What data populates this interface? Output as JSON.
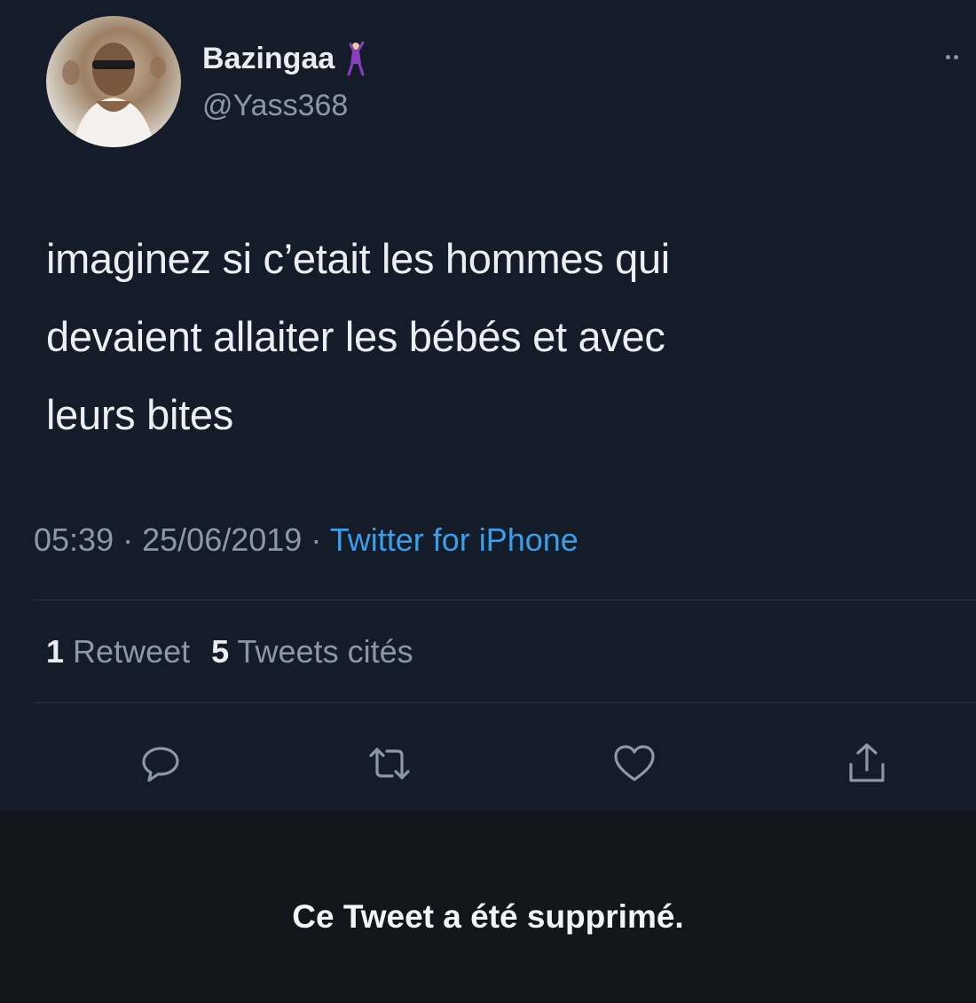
{
  "tweet": {
    "author": {
      "display_name": "Bazingaa",
      "handle": "@Yass368",
      "name_emoji": "dancing-person-emoji"
    },
    "text_lines": [
      "imaginez si c’etait les hommes qui",
      "devaient allaiter les bébés et avec",
      "leurs bites"
    ],
    "time": "05:39",
    "date": "25/06/2019",
    "separator": "·",
    "source": "Twitter for iPhone",
    "stats": {
      "retweets_count": "1",
      "retweets_label": "Retweet",
      "quotes_count": "5",
      "quotes_label": "Tweets cités"
    },
    "actions": [
      "reply-icon",
      "retweet-icon",
      "like-icon",
      "share-icon"
    ]
  },
  "deleted_notice": "Ce Tweet a été supprimé.",
  "colors": {
    "background": "#151c29",
    "banner": "#11161d",
    "secondary_text": "#8b98a5",
    "link": "#3a9ee8"
  }
}
